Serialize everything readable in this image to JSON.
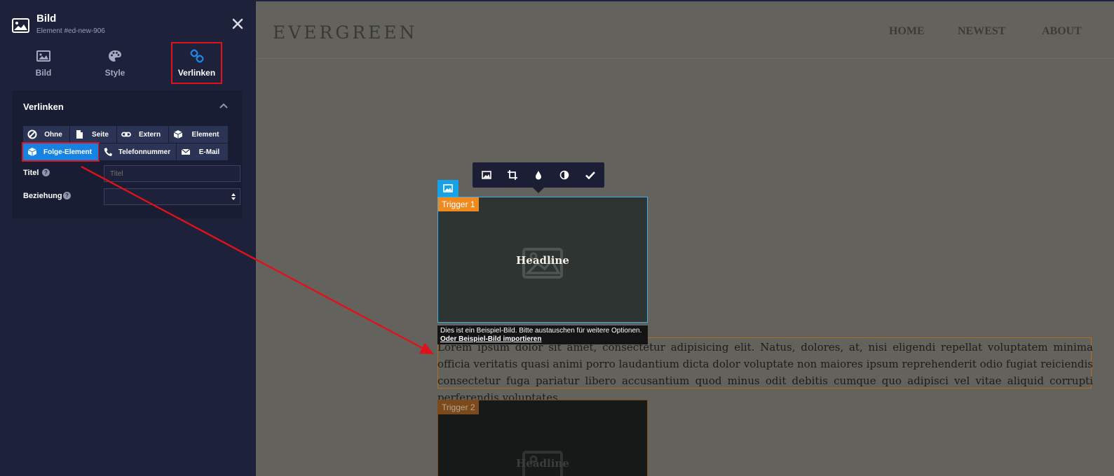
{
  "sidebar": {
    "title": "Bild",
    "subtitle": "Element #ed-new-906",
    "tabs": [
      {
        "label": "Bild"
      },
      {
        "label": "Style"
      },
      {
        "label": "Verlinken"
      }
    ],
    "section_title": "Verlinken",
    "link_options": [
      {
        "label": "Ohne",
        "icon": "ban-icon"
      },
      {
        "label": "Seite",
        "icon": "page-icon"
      },
      {
        "label": "Extern",
        "icon": "link-icon"
      },
      {
        "label": "Element",
        "icon": "cube-icon"
      },
      {
        "label": "Folge-Element",
        "icon": "cube-icon"
      },
      {
        "label": "Telefonnummer",
        "icon": "phone-icon"
      },
      {
        "label": "E-Mail",
        "icon": "mail-icon"
      }
    ],
    "selected_option": "Folge-Element",
    "fields": {
      "title_label": "Titel",
      "title_placeholder": "Titel",
      "relation_label": "Beziehung",
      "relation_value": ""
    }
  },
  "site": {
    "logo": "EVERGREEN",
    "nav": [
      "HOME",
      "NEWEST",
      "ABOUT"
    ],
    "headline": "Headline",
    "trigger_1": "Trigger 1",
    "trigger_2": "Trigger 2",
    "caption_text": "Dies ist ein Beispiel-Bild. Bitte austauschen für weitere Optionen.",
    "caption_link": "Oder Beispiel-Bild importieren",
    "paragraph": "Lorem ipsum dolor sit amet, consectetur adipisicing elit. Natus, dolores, at, nisi eligendi repellat voluptatem minima officia veritatis quasi animi porro laudantium dicta dolor voluptate non maiores ipsum reprehenderit odio fugiat reiciendis consectetur fuga pariatur libero accusantium quod minus odit debitis cumque quo adipisci vel vitae aliquid corrupti perferendis voluptates."
  },
  "colors": {
    "sidebar_bg": "#1d2139",
    "selected_blue": "#1683e3",
    "highlight_red": "#e0111b",
    "trigger_orange": "#f08a1e",
    "badge_cyan": "#17a2e8"
  }
}
